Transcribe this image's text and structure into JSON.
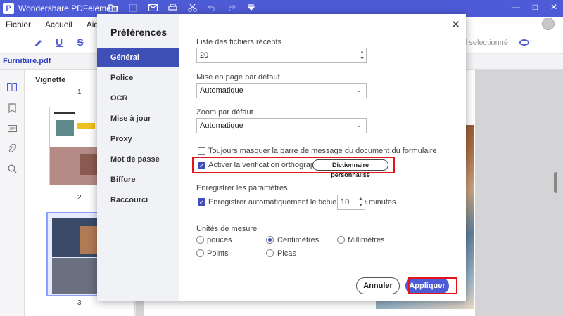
{
  "window": {
    "app_title": "Wondershare PDFelement",
    "logo_letter": "P",
    "controls": [
      "—",
      "□",
      "✕"
    ]
  },
  "menu": [
    "Fichier",
    "Accueil",
    "Aide"
  ],
  "toolbar": {
    "hint": "outil selectionné"
  },
  "tab": {
    "file_name": "Furniture.pdf"
  },
  "thumbnails": {
    "title": "Vignette",
    "pages": [
      "1",
      "2",
      "3"
    ]
  },
  "dialog": {
    "title": "Préférences",
    "nav": [
      "Général",
      "Police",
      "OCR",
      "Mise à jour",
      "Proxy",
      "Mot de passe",
      "Biffure",
      "Raccourci"
    ],
    "active_nav": "Général",
    "recent_files_label": "Liste des fichiers récents",
    "recent_files_value": "20",
    "layout_label": "Mise en page par défaut",
    "layout_value": "Automatique",
    "zoom_label": "Zoom par défaut",
    "zoom_value": "Automatique",
    "hide_msg_bar_label": "Toujours masquer la barre de message du document du formulaire",
    "spellcheck_label": "Activer la vérification orthographique",
    "custom_dict_button": "Dictionnaire personnalisé",
    "save_settings_label": "Enregistrer les paramètres",
    "autosave_label": "Enregistrer automatiquement le fichier chaque",
    "autosave_value": "10",
    "autosave_unit": "minutes",
    "units_label": "Unités de mesure",
    "units": [
      "pouces",
      "Centimètres",
      "Millimètres",
      "Points",
      "Picas"
    ],
    "selected_unit": "Centimètres",
    "cancel_button": "Annuler",
    "apply_button": "Appliquer"
  },
  "colors": {
    "accent": "#4e5bd6",
    "highlight_box": "#e3141c"
  }
}
